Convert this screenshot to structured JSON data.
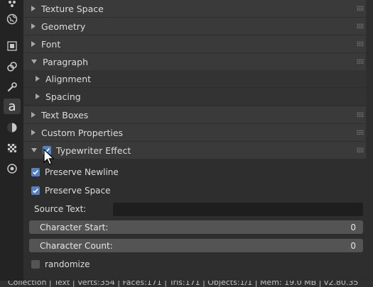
{
  "tabs": [
    {
      "icon": "particles-icon"
    },
    {
      "icon": "world-icon"
    },
    {
      "icon": "object-icon"
    },
    {
      "icon": "constraints-icon"
    },
    {
      "icon": "modifier-wrench-icon"
    },
    {
      "icon": "text-data-icon",
      "active": true
    },
    {
      "icon": "material-icon"
    },
    {
      "icon": "texture-icon"
    },
    {
      "icon": "physics-icon"
    }
  ],
  "panels": {
    "texture_space": "Texture Space",
    "geometry": "Geometry",
    "font": "Font",
    "paragraph": "Paragraph",
    "alignment": "Alignment",
    "spacing": "Spacing",
    "text_boxes": "Text Boxes",
    "custom_properties": "Custom Properties",
    "typewriter_effect": "Typewriter Effect"
  },
  "typewriter": {
    "enabled": true,
    "preserve_newline": {
      "label": "Preserve Newline",
      "checked": true
    },
    "preserve_space": {
      "label": "Preserve Space",
      "checked": true
    },
    "source_text": {
      "label": "Source Text:",
      "value": ""
    },
    "character_start": {
      "label": "Character Start:",
      "value": "0"
    },
    "character_count": {
      "label": "Character Count:",
      "value": "0"
    },
    "randomize": {
      "label": "randomize",
      "checked": false
    }
  },
  "status_bar": "Collection | Text | Verts:354 | Faces:171 | Tris:171 | Objects:1/1 | Mem: 19.0 MB | v2.80.35",
  "colors": {
    "accent": "#5680c2",
    "panel_header": "#3a3a3a",
    "background": "#2e2e2e"
  }
}
